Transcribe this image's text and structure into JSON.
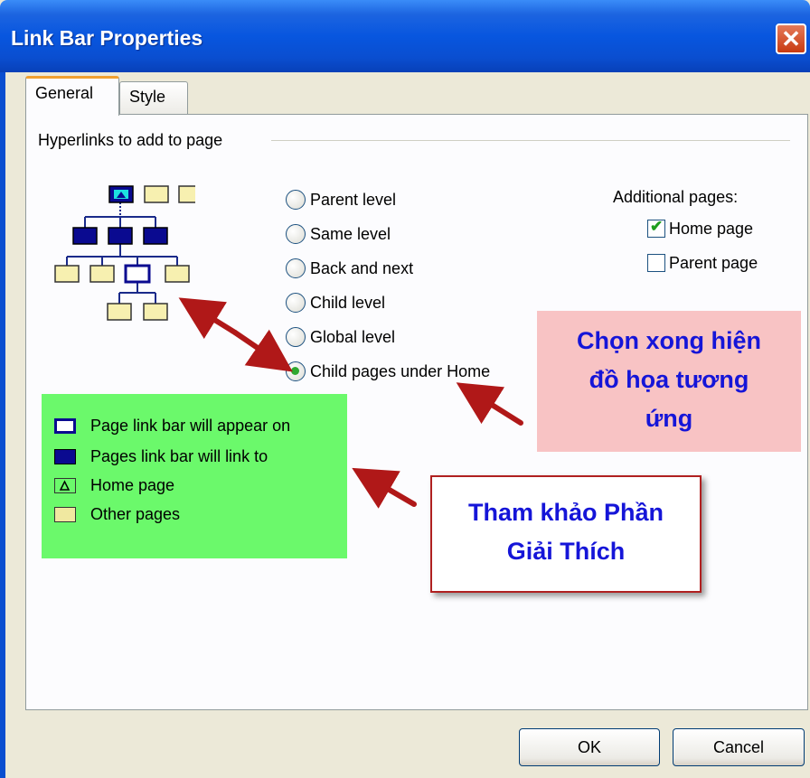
{
  "window": {
    "title": "Link Bar Properties",
    "close_glyph": "✕"
  },
  "tabs": [
    {
      "label": "General",
      "active": true
    },
    {
      "label": "Style",
      "active": false
    }
  ],
  "group_label": "Hyperlinks to add to page",
  "radio_options": [
    {
      "label": "Parent level",
      "checked": false
    },
    {
      "label": "Same level",
      "checked": false
    },
    {
      "label": "Back and next",
      "checked": false
    },
    {
      "label": "Child level",
      "checked": false
    },
    {
      "label": "Global level",
      "checked": false
    },
    {
      "label": "Child pages under Home",
      "checked": true
    }
  ],
  "additional_pages": {
    "label": "Additional pages:",
    "items": [
      {
        "label": "Home page",
        "checked": true
      },
      {
        "label": "Parent page",
        "checked": false
      }
    ]
  },
  "annotation_pink": {
    "lines": [
      "Chọn xong hiện",
      "đồ họa tương",
      "ứng"
    ]
  },
  "legend": {
    "items": [
      {
        "label": "Page link bar will appear on",
        "icon": "page-outline-icon"
      },
      {
        "label": "Pages link bar will link to",
        "icon": "page-filled-icon"
      },
      {
        "label": "Home page",
        "icon": "home-page-icon"
      },
      {
        "label": "Other pages",
        "icon": "other-page-icon"
      }
    ]
  },
  "annotation_ref": {
    "lines": [
      "Tham khảo Phần",
      "Giải Thích"
    ]
  },
  "buttons": {
    "ok": "OK",
    "cancel": "Cancel"
  },
  "colors": {
    "titlebar": "#0856df",
    "pink_box": "#f8c3c4",
    "legend_box": "#6bf96b",
    "annotation_text": "#1515d8",
    "arrow": "#b01818"
  }
}
